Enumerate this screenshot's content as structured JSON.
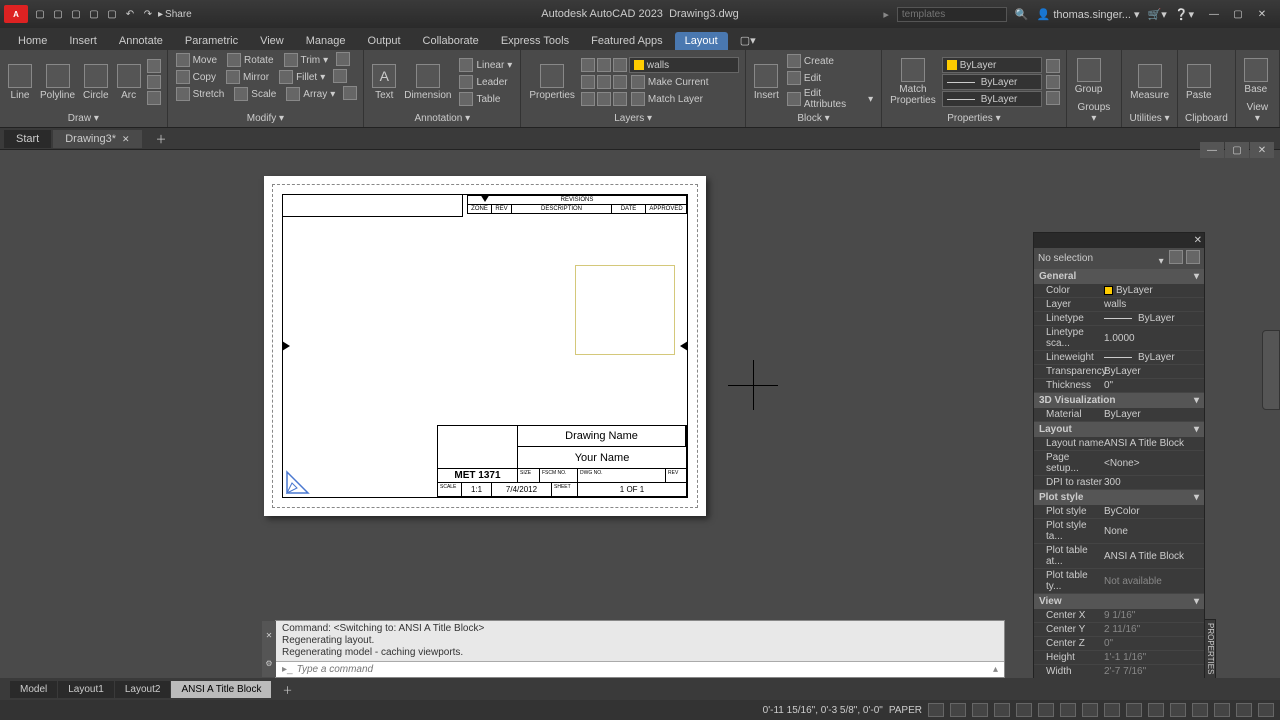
{
  "titlebar": {
    "app": "Autodesk AutoCAD 2023",
    "file": "Drawing3.dwg",
    "share": "Share",
    "search_ph": "templates",
    "user": "thomas.singer..."
  },
  "tabs": [
    "Home",
    "Insert",
    "Annotate",
    "Parametric",
    "View",
    "Manage",
    "Output",
    "Collaborate",
    "Express Tools",
    "Featured Apps",
    "Layout"
  ],
  "active_tab": "Layout",
  "ribbon": {
    "draw": {
      "title": "Draw ▾",
      "items": [
        "Line",
        "Polyline",
        "Circle",
        "Arc"
      ]
    },
    "modify": {
      "title": "Modify ▾",
      "items": [
        "Move",
        "Rotate",
        "Trim",
        "Copy",
        "Mirror",
        "Fillet",
        "Stretch",
        "Scale",
        "Array"
      ]
    },
    "annotation": {
      "title": "Annotation ▾",
      "text": "Text",
      "dim": "Dimension",
      "linear": "Linear",
      "leader": "Leader",
      "table": "Table"
    },
    "layers": {
      "title": "Layers ▾",
      "current": "walls",
      "make_current": "Make Current",
      "match": "Match Layer",
      "props": "Properties"
    },
    "block": {
      "title": "Block ▾",
      "insert": "Insert",
      "create": "Create",
      "edit": "Edit",
      "editattr": "Edit Attributes"
    },
    "properties": {
      "title": "Properties ▾",
      "match": "Match\nProperties",
      "bylayer": "ByLayer"
    },
    "groups": {
      "title": "Groups ▾",
      "group": "Group"
    },
    "utilities": {
      "title": "Utilities ▾",
      "measure": "Measure"
    },
    "clipboard": {
      "title": "Clipboard",
      "paste": "Paste"
    },
    "view": {
      "title": "View ▾",
      "base": "Base"
    }
  },
  "doc_tabs": {
    "start": "Start",
    "drawing": "Drawing3*"
  },
  "drawing": {
    "rev_title": "REVISIONS",
    "rev_cols": [
      "ZONE",
      "REV",
      "DESCRIPTION",
      "DATE",
      "APPROVED"
    ],
    "dname": "Drawing Name",
    "yname": "Your Name",
    "course": "MET 1371",
    "scale_lbl": "SCALE",
    "scale": "1:1",
    "date": "7/4/2012",
    "sheet_lbl": "SHEET",
    "sheet": "1 OF 1",
    "size_lbl": "SIZE",
    "fscm_lbl": "FSCM NO.",
    "dwg_lbl": "DWG NO.",
    "rev_lbl": "REV"
  },
  "props": {
    "sel": "No selection",
    "cats": {
      "general": "General",
      "viz": "3D Visualization",
      "layout": "Layout",
      "plot": "Plot style",
      "view": "View"
    },
    "rows": {
      "color_k": "Color",
      "color_v": "ByLayer",
      "layer_k": "Layer",
      "layer_v": "walls",
      "ltype_k": "Linetype",
      "ltype_v": "ByLayer",
      "ltscale_k": "Linetype sca...",
      "ltscale_v": "1.0000",
      "lweight_k": "Lineweight",
      "lweight_v": "ByLayer",
      "trans_k": "Transparency",
      "trans_v": "ByLayer",
      "thick_k": "Thickness",
      "thick_v": "0\"",
      "mat_k": "Material",
      "mat_v": "ByLayer",
      "lname_k": "Layout name",
      "lname_v": "ANSI A Title Block",
      "psetup_k": "Page setup...",
      "psetup_v": "<None>",
      "dpi_k": "DPI to raster",
      "dpi_v": "300",
      "pstyle_k": "Plot style",
      "pstyle_v": "ByColor",
      "pstab_k": "Plot style ta...",
      "pstab_v": "None",
      "ptatt_k": "Plot table at...",
      "ptatt_v": "ANSI A Title Block",
      "pttyp_k": "Plot table ty...",
      "pttyp_v": "Not available",
      "cx_k": "Center X",
      "cx_v": "9 1/16\"",
      "cy_k": "Center Y",
      "cy_v": "2 11/16\"",
      "cz_k": "Center Z",
      "cz_v": "0\"",
      "h_k": "Height",
      "h_v": "1'-1 1/16\"",
      "w_k": "Width",
      "w_v": "2'-7 7/16\""
    },
    "side_label": "PROPERTIES"
  },
  "cmd": {
    "l1": "Command:   <Switching to: ANSI A Title Block>",
    "l2": "Regenerating layout.",
    "l3": "Regenerating model - caching viewports.",
    "ph": "Type a command"
  },
  "layout_tabs": [
    "Model",
    "Layout1",
    "Layout2",
    "ANSI A Title Block"
  ],
  "active_layout": "ANSI A Title Block",
  "status": {
    "coords": "0'-11 15/16\", 0'-3 5/8\", 0'-0\"",
    "mode": "PAPER"
  }
}
